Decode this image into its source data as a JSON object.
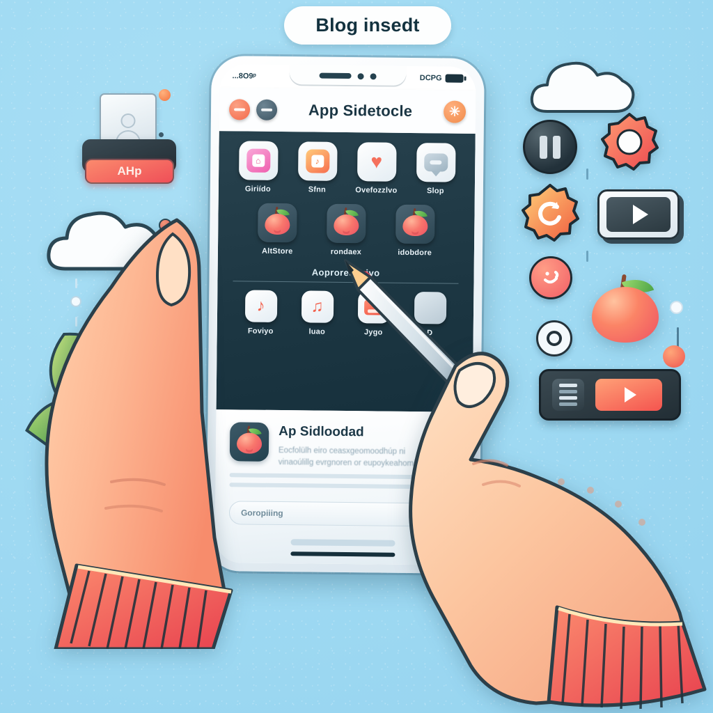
{
  "scene": {
    "background_color": "#9ed9f2",
    "title_pill": {
      "label": "Blog insedt"
    }
  },
  "phone": {
    "status_bar": {
      "left_text": "...8O9ᵖ",
      "right_text": "DCPG",
      "battery_icon": "battery-icon"
    },
    "app_bar": {
      "title": "App Sidetocle",
      "left_button_1": "minus-circle-icon",
      "left_button_2": "minus-circle-dark-icon",
      "close_button": "close-icon",
      "close_glyph": "✳"
    },
    "app_grid_row1": [
      {
        "label": "Giriído",
        "icon": "pink-square-app-icon"
      },
      {
        "label": "Sfnn",
        "icon": "orange-square-app-icon"
      },
      {
        "label": "Ovefozzlvo",
        "icon": "heart-app-icon",
        "glyph": "♥"
      },
      {
        "label": "Slop",
        "icon": "chat-bubble-app-icon"
      }
    ],
    "app_grid_row2": [
      {
        "label": "AltStore",
        "icon": "apple-app-icon"
      },
      {
        "label": "rondaex",
        "icon": "apple-app-icon"
      },
      {
        "label": "idobdore",
        "icon": "apple-app-icon"
      }
    ],
    "section_heading": "Aoproredenivo",
    "app_grid_row3": [
      {
        "label": "Foviyo",
        "icon": "music-note-app-icon",
        "glyph": "♪"
      },
      {
        "label": "luao",
        "icon": "music-note-app-icon",
        "glyph": "♫"
      },
      {
        "label": "Jygo",
        "icon": "card-app-icon"
      },
      {
        "label": "D",
        "icon": "hidden-app-icon"
      }
    ],
    "promo_card": {
      "title": "Ap Sidloodad",
      "line1": "Eocfolülh eiro ceasxgeomoodhúp ni",
      "line2": "vinaoúlillg evrgnoren or eupoykeahomih",
      "icon": "apple-card-icon"
    },
    "search": {
      "value": "Goropiiing",
      "placeholder": "Goropiiing",
      "button_glyph": "➚",
      "button_name": "search-go-button"
    },
    "home_indicator": "home-indicator"
  },
  "left_decor": {
    "id_card": "person-card-icon",
    "dock_slot": "dock-slot",
    "dock_button_label": "AHp",
    "cloud_top": "cloud-icon",
    "cloud_bottom": "cloud-icon",
    "leaves": "leaf-icon"
  },
  "right_decor": {
    "pause_button": "pause-icon",
    "gear_red": "gear-icon",
    "gear_orange": "gear-refresh-icon",
    "play_card": "play-icon",
    "smiley_button": "smiley-icon",
    "record_button": "record-icon",
    "apple": "apple-icon",
    "toolbar_list": "list-icon",
    "toolbar_play": "play-icon"
  },
  "hands": {
    "left_hand": "left-hand-thumb",
    "right_hand": "right-hand-pointing",
    "stylus": "stylus-pencil"
  },
  "colors": {
    "background": "#9ed9f2",
    "accent_red": "#ee5262",
    "accent_orange": "#f4694a",
    "dark_screen": "#1d3743",
    "skin": "#fbc9a6",
    "sleeve_red": "#ef4f58",
    "leaf_green": "#5fae4f"
  }
}
